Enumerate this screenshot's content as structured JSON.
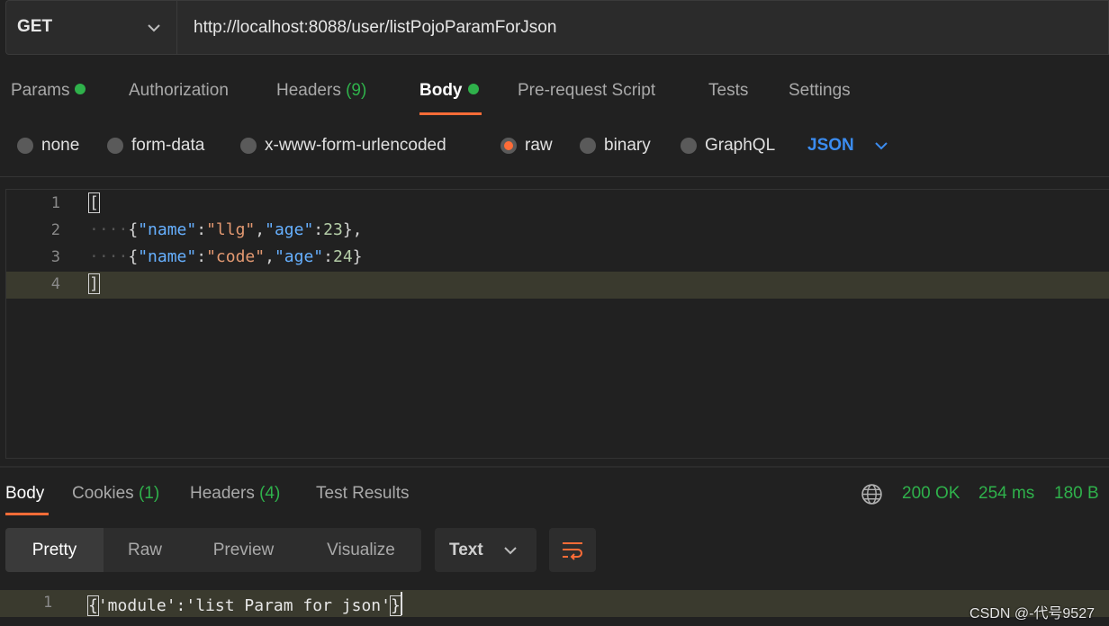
{
  "request": {
    "method": "GET",
    "url": "http://localhost:8088/user/listPojoParamForJson"
  },
  "request_tabs": {
    "params": "Params",
    "authorization": "Authorization",
    "headers": "Headers",
    "headers_count": "(9)",
    "body": "Body",
    "pre_request": "Pre-request Script",
    "tests": "Tests",
    "settings": "Settings"
  },
  "body_types": {
    "none": "none",
    "form_data": "form-data",
    "urlencoded": "x-www-form-urlencoded",
    "raw": "raw",
    "binary": "binary",
    "graphql": "GraphQL",
    "selected_type": "raw",
    "format": "JSON"
  },
  "editor": {
    "line_numbers": [
      "1",
      "2",
      "3",
      "4"
    ],
    "line1": "[",
    "line2_indent": "····",
    "line2_open": "{",
    "line2_key1": "\"name\"",
    "line2_colon1": ":",
    "line2_val1": "\"llg\"",
    "line2_comma1": ",",
    "line2_key2": "\"age\"",
    "line2_colon2": ":",
    "line2_val2": "23",
    "line2_close": "},",
    "line3_indent": "····",
    "line3_open": "{",
    "line3_key1": "\"name\"",
    "line3_colon1": ":",
    "line3_val1": "\"code\"",
    "line3_comma1": ",",
    "line3_key2": "\"age\"",
    "line3_colon2": ":",
    "line3_val2": "24",
    "line3_close": "}",
    "line4": "]"
  },
  "response_tabs": {
    "body": "Body",
    "cookies": "Cookies",
    "cookies_count": "(1)",
    "headers": "Headers",
    "headers_count": "(4)",
    "test_results": "Test Results"
  },
  "response_status": {
    "status": "200 OK",
    "time": "254 ms",
    "size": "180 B"
  },
  "response_view": {
    "pretty": "Pretty",
    "raw": "Raw",
    "preview": "Preview",
    "visualize": "Visualize",
    "format": "Text"
  },
  "response_body": {
    "line_number": "1",
    "open": "{",
    "content": "'module':'list Param for json'",
    "close": "}"
  },
  "watermark": "CSDN @-代号9527",
  "colors": {
    "accent": "#ff6c37",
    "success": "#2fb14b",
    "link": "#3b8cf0"
  }
}
